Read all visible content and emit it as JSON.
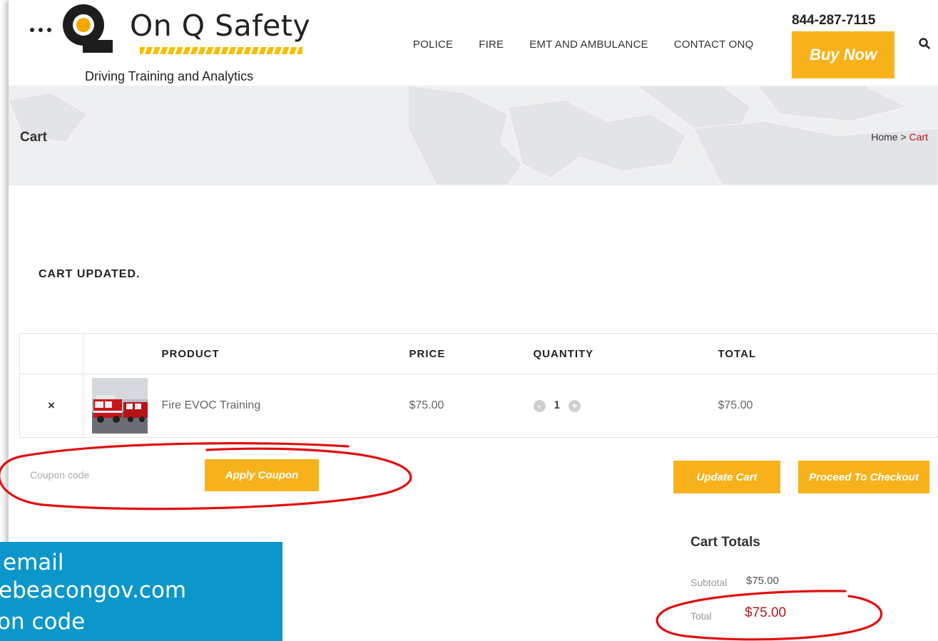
{
  "header": {
    "logo_name": "On Q Safety",
    "tagline": "Driving Training and Analytics",
    "phone": "844-287-7115",
    "buy_now_label": "Buy Now",
    "nav": [
      "POLICE",
      "FIRE",
      "EMT AND AMBULANCE",
      "CONTACT ONQ"
    ],
    "search_icon": "search-icon"
  },
  "hero": {
    "title": "Cart",
    "breadcrumb_home": "Home",
    "breadcrumb_sep": " > ",
    "breadcrumb_current": "Cart"
  },
  "notice": "CART UPDATED.",
  "cart": {
    "headers": {
      "product": "PRODUCT",
      "price": "PRICE",
      "quantity": "QUANTITY",
      "total": "TOTAL"
    },
    "items": [
      {
        "remove": "×",
        "product": "Fire EVOC Training",
        "price": "$75.00",
        "quantity": "1",
        "total": "$75.00",
        "thumb": "fire-truck-thumbnail"
      }
    ],
    "qty_minus": "-",
    "qty_plus": "+"
  },
  "actions": {
    "coupon_placeholder": "Coupon code",
    "apply_coupon_label": "Apply Coupon",
    "update_cart_label": "Update Cart",
    "checkout_label": "Proceed To Checkout"
  },
  "totals": {
    "title": "Cart Totals",
    "subtotal_label": "Subtotal",
    "subtotal_value": "$75.00",
    "total_label": "Total",
    "total_value": "$75.00"
  },
  "overlay": {
    "lines": [
      "email",
      "ebeacongov.com",
      "on code"
    ]
  },
  "colors": {
    "accent": "#f7b21b",
    "price_red": "#b01b1b",
    "overlay_blue": "#0c97cb",
    "annotation_red": "#e01010"
  }
}
